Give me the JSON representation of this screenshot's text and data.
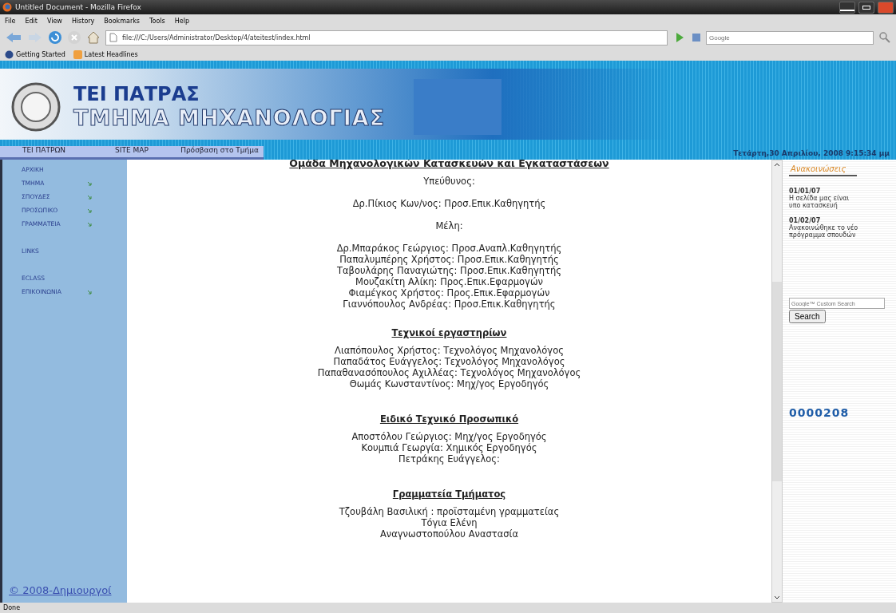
{
  "window": {
    "title": "Untitled Document - Mozilla Firefox"
  },
  "menu": [
    "File",
    "Edit",
    "View",
    "History",
    "Bookmarks",
    "Tools",
    "Help"
  ],
  "address_bar": {
    "value": "file:///C:/Users/Administrator/Desktop/4/ateitest/index.html"
  },
  "search_bar": {
    "placeholder": "Google"
  },
  "bookmarks": [
    "Getting Started",
    "Latest Headlines"
  ],
  "banner": {
    "title": "ΤΕΙ ΠΑΤΡΑΣ",
    "subtitle": "ΤΜΗΜΑ ΜΗΧΑΝΟΛΟΓΙΑΣ"
  },
  "top_tabs": [
    "ΤΕΙ ΠΑΤΡΩΝ",
    "SITE MAP",
    "Πρόσβαση στο Τμήμα"
  ],
  "date": "Τετάρτη,30 Απριλίου, 2008 9:15:34 μμ",
  "sidebar": {
    "groups": [
      [
        {
          "label": "ΑΡΧΙΚΗ",
          "has_submenu": false
        },
        {
          "label": "ΤΜΗΜΑ",
          "has_submenu": true
        },
        {
          "label": "ΣΠΟΥΔΕΣ",
          "has_submenu": true
        },
        {
          "label": "ΠΡΟΣΩΠΙΚΟ",
          "has_submenu": true
        },
        {
          "label": "ΓΡΑΜΜΑΤΕΙΑ",
          "has_submenu": true
        }
      ],
      [
        {
          "label": "LINKS",
          "has_submenu": false
        }
      ],
      [
        {
          "label": "ECLASS",
          "has_submenu": false
        },
        {
          "label": "ΕΠΙΚΟΙΝΩΝΙΑ",
          "has_submenu": true
        }
      ]
    ],
    "footer": "© 2008-Δημιουργοί"
  },
  "sections": [
    {
      "heading": "Ομάδα Μηχανολογικών Κατασκευών και Εγκαταστάσεων",
      "groups": [
        [
          "Υπεύθυνος:"
        ],
        [
          "Δρ.Πίκιος Κων/νος: Προσ.Επικ.Καθηγητής"
        ],
        [
          "Μέλη:"
        ],
        [
          "Δρ.Μπαράκος Γεώργιος: Προσ.Αναπλ.Καθηγητής",
          "Παπαλυμπέρης Χρήστος: Προσ.Επικ.Καθηγητής",
          "Ταβουλάρης Παναγιώτης: Προσ.Επικ.Καθηγητής",
          "Μουζακίτη Αλίκη: Προς.Επικ.Εφαρμογών",
          "Φιαμέγκος Χρήστος: Προς.Επικ.Εφαρμογών",
          "Γιαννόπουλος Ανδρέας: Προσ.Επικ.Καθηγητής"
        ]
      ]
    },
    {
      "heading": "Τεχνικοί εργαστηρίων",
      "groups": [
        [
          "Λιαπόπουλος  Χρήστος: Τεχνολόγος  Μηχανολόγος",
          "Παπαδάτος  Ευάγγελος: Τεχνολόγος  Μηχανολόγος",
          "Παπαθανασόπουλος Αχιλλέας: Τεχνολόγος  Μηχανολόγος",
          "Θωμάς Κωνσταντίνος: Μηχ/γος  Εργοδηγός"
        ]
      ]
    },
    {
      "heading": "Ειδικό Τεχνικό Προσωπικό",
      "groups": [
        [
          "Αποστόλου Γεώργιος:  Μηχ/γος  Εργοδηγός",
          "Κουμπιά Γεωργία: Χημικός  Εργοδηγός",
          "Πετράκης Ευάγγελος:"
        ]
      ]
    },
    {
      "heading": "Γραμματεία Τμήματος",
      "groups": [
        [
          "Τζουβάλη Βασιλική : προϊσταμένη γραμματείας",
          "Τόγια Ελένη",
          "Αναγνωστοπούλου Αναστασία"
        ]
      ]
    }
  ],
  "announcements": {
    "title": "Ανακοινώσεις",
    "items": [
      {
        "date": "01/01/07",
        "text": "Η σελίδα μας είναι υπο κατασκευή"
      },
      {
        "date": "01/02/07",
        "text": "Ανακοινώθηκε το νέο πρόγραμμα σπουδών"
      }
    ]
  },
  "site_search": {
    "placeholder": "Google™ Custom Search",
    "button": "Search"
  },
  "counter": "0000208",
  "status_bar": "Done"
}
